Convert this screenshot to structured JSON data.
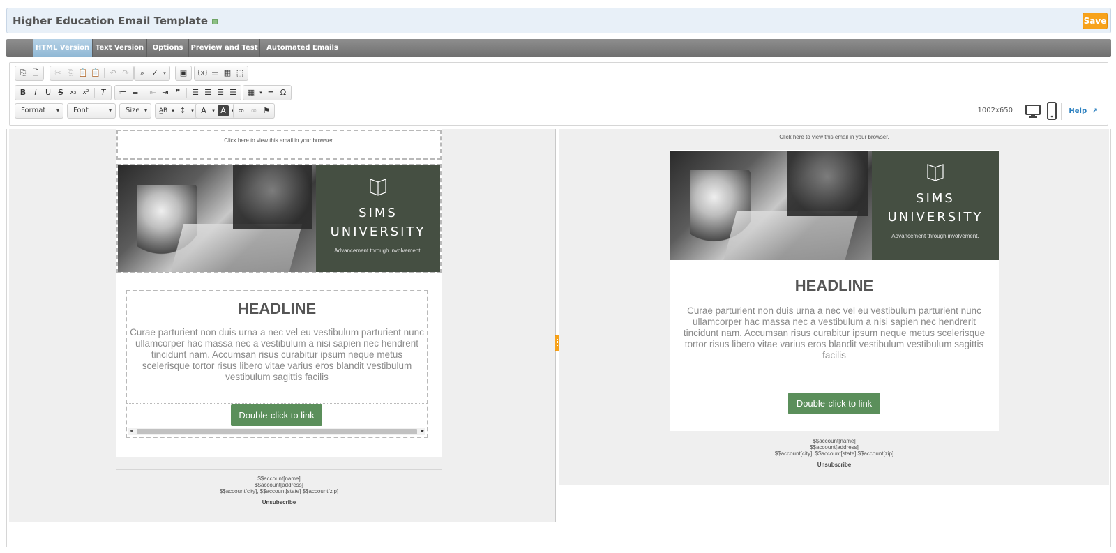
{
  "header": {
    "title": "Higher Education Email Template",
    "save_label": "Save"
  },
  "tabs": [
    {
      "label": "HTML Version",
      "active": true
    },
    {
      "label": "Text Version",
      "active": false
    },
    {
      "label": "Options",
      "active": false
    },
    {
      "label": "Preview and Test",
      "active": false
    },
    {
      "label": "Automated Emails (0)",
      "active": false
    }
  ],
  "toolbar": {
    "format_label": "Format",
    "font_label": "Font",
    "size_label": "Size",
    "dimensions": "1002x650",
    "help_label": "Help"
  },
  "email": {
    "preheader": "Click here to view this email in your browser.",
    "brand_name_line1": "SIMS",
    "brand_name_line2": "UNIVERSITY",
    "brand_tagline": "Advancement through involvement.",
    "headline": "HEADLINE",
    "body": "Curae parturient non duis urna a nec vel eu vestibulum parturient nunc ullamcorper hac massa nec a vestibulum a nisi sapien nec hendrerit tincidunt nam. Accumsan risus curabitur ipsum neque metus scelerisque tortor risus libero vitae varius eros blandit vestibulum vestibulum sagittis facilis",
    "cta_label": "Double-click to link",
    "footer_name": "$$account[name]",
    "footer_address": "$$account[address]",
    "footer_city_state_zip": "$$account[city], $$account[state] $$account[zip]",
    "unsubscribe": "Unsubscribe"
  },
  "colors": {
    "accent": "#f7a21b",
    "brand_panel": "#454f42",
    "cta": "#5b8f5b",
    "active_tab": "#9dc3dc"
  }
}
